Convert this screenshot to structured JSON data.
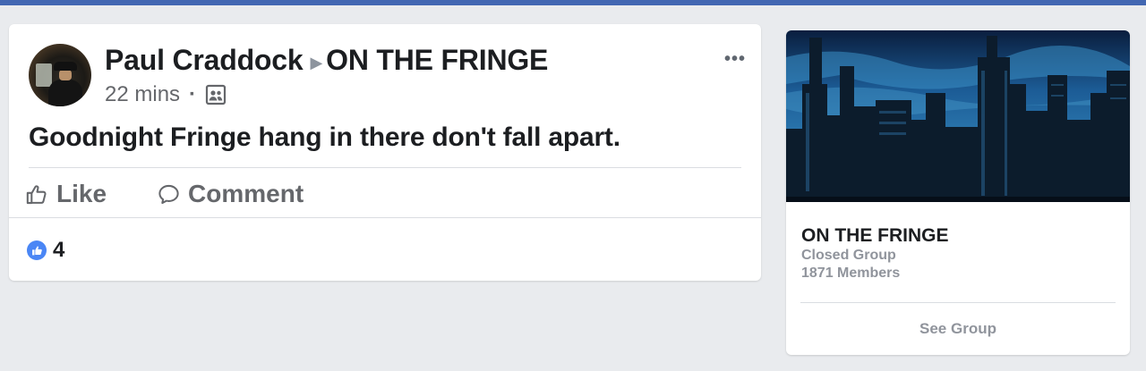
{
  "post": {
    "author": "Paul Craddock",
    "arrow_icon": "right-triangle-icon",
    "group": "ON THE FRINGE",
    "time": "22 mins",
    "separator": "·",
    "audience_icon": "group-members-icon",
    "more_icon": "more-options-icon",
    "text": "Goodnight Fringe hang in there don't fall apart.",
    "actions": {
      "like": "Like",
      "comment": "Comment"
    },
    "reaction_count": "4"
  },
  "group_card": {
    "name": "ON THE FRINGE",
    "privacy": "Closed Group",
    "members": "1871 Members",
    "cta": "See Group"
  },
  "colors": {
    "brand": "#4267b2",
    "like_blue": "#4a86f5",
    "muted_text": "#65676b",
    "page_bg": "#e9ebee"
  }
}
